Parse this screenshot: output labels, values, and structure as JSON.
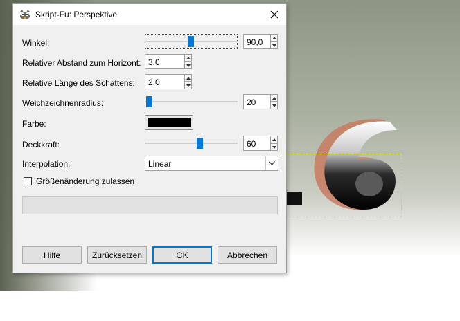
{
  "window": {
    "title": "Skript-Fu: Perspektive"
  },
  "params": {
    "winkel": {
      "label": "Winkel:",
      "value": "90,0",
      "slider_fraction": 0.5
    },
    "abstand": {
      "label": "Relativer Abstand zum Horizont:",
      "value": "3,0"
    },
    "laenge": {
      "label": "Relative Länge des Schattens:",
      "value": "2,0"
    },
    "weichzeichnen": {
      "label": "Weichzeichnenradius:",
      "value": "20",
      "slider_fraction": 0.0
    },
    "farbe": {
      "label": "Farbe:",
      "color": "#000000"
    },
    "deckkraft": {
      "label": "Deckkraft:",
      "value": "60",
      "slider_fraction": 0.6
    },
    "interpolation": {
      "label": "Interpolation:",
      "value": "Linear"
    },
    "groesse": {
      "label": "Größenänderung zulassen",
      "checked": false
    }
  },
  "buttons": {
    "hilfe": "Hilfe",
    "zuruecksetzen": "Zurücksetzen",
    "ok": "OK",
    "abbrechen": "Abbrechen"
  },
  "colors": {
    "accent": "#0078d7",
    "dialog_bg": "#f0f0f0"
  }
}
